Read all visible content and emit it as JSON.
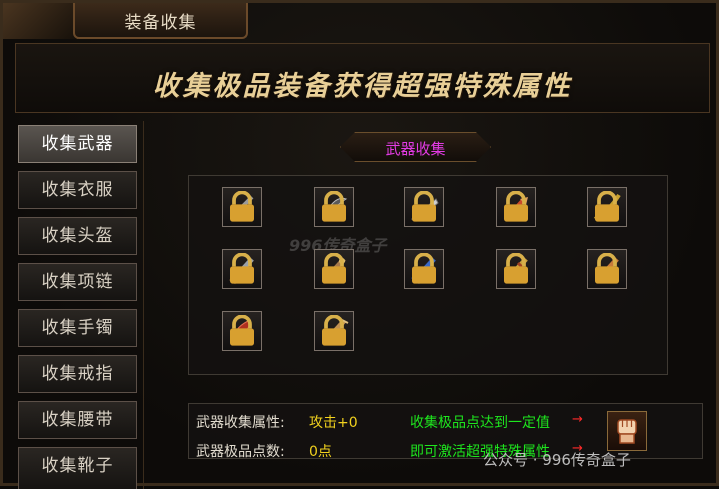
{
  "window": {
    "title": "装备收集"
  },
  "banner": {
    "text": "收集极品装备获得超强特殊属性"
  },
  "sidebar": {
    "items": [
      {
        "label": "收集武器",
        "active": true
      },
      {
        "label": "收集衣服",
        "active": false
      },
      {
        "label": "收集头盔",
        "active": false
      },
      {
        "label": "收集项链",
        "active": false
      },
      {
        "label": "收集手镯",
        "active": false
      },
      {
        "label": "收集戒指",
        "active": false
      },
      {
        "label": "收集腰带",
        "active": false
      },
      {
        "label": "收集靴子",
        "active": false
      }
    ]
  },
  "section": {
    "title": "武器收集"
  },
  "weapons": [
    {
      "icon": "weapon-slot-1-icon",
      "locked": true
    },
    {
      "icon": "weapon-slot-2-icon",
      "locked": true
    },
    {
      "icon": "weapon-slot-3-icon",
      "locked": true
    },
    {
      "icon": "weapon-slot-4-icon",
      "locked": true
    },
    {
      "icon": "weapon-slot-5-icon",
      "locked": true
    },
    {
      "icon": "weapon-slot-6-icon",
      "locked": true
    },
    {
      "icon": "weapon-slot-7-icon",
      "locked": true
    },
    {
      "icon": "weapon-slot-8-icon",
      "locked": true
    },
    {
      "icon": "weapon-slot-9-icon",
      "locked": true
    },
    {
      "icon": "weapon-slot-10-icon",
      "locked": true
    },
    {
      "icon": "weapon-slot-11-icon",
      "locked": true
    },
    {
      "icon": "weapon-slot-12-icon",
      "locked": true
    }
  ],
  "watermark": {
    "text": "996传奇盒子"
  },
  "info": {
    "attr_label": "武器收集属性:",
    "attr_value": "攻击+0",
    "points_label": "武器极品点数:",
    "points_value": "0点",
    "tip_line1": "收集极品点达到一定值",
    "tip_line2": "即可激活超强特殊属性",
    "arrow": "→"
  },
  "overlay": {
    "text": "公众号 · 996传奇盒子"
  },
  "colors": {
    "accent_tab": "#e23be4",
    "value": "#f2d21e",
    "tip": "#1ee61e",
    "arrow": "#ff2a2a"
  }
}
